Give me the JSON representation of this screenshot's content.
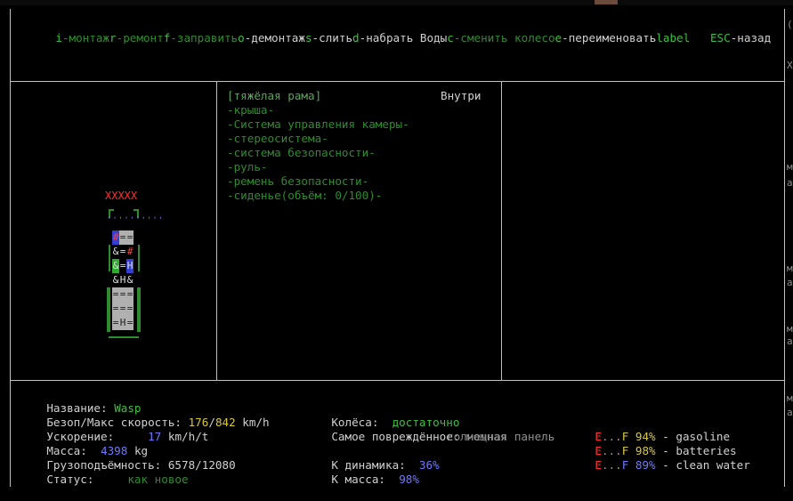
{
  "hotkeys": [
    {
      "key": "i",
      "label": "-монтаж"
    },
    {
      "key": "r",
      "label": "-ремонт"
    },
    {
      "key": "f",
      "label": "-заправить"
    },
    {
      "key": "o",
      "label": "-демонтаж"
    },
    {
      "key": "s",
      "label": "-слить"
    },
    {
      "key": "d",
      "label": "-набрать Воды"
    },
    {
      "key": "c",
      "label": "-сменить колесо"
    },
    {
      "key": "e",
      "label": "-переименовать"
    },
    {
      "key": "",
      "label": "label"
    },
    {
      "key": "ESC",
      "label": "-назад"
    }
  ],
  "right_edge_glyphs": [
    "(",
    "X",
    "м",
    "а",
    "м",
    "а",
    "м",
    "а",
    "м",
    "а"
  ],
  "vehicle": {
    "header_marks": "XXXXX",
    "grid_glyphs": [
      "#",
      "=",
      "=",
      "&",
      "=",
      "#",
      "&",
      "=",
      "H",
      "&",
      "H",
      "&",
      "=",
      "=",
      "=",
      "=",
      "=",
      "=",
      "=",
      "H",
      "="
    ]
  },
  "parts_panel": {
    "title": "[тяжёлая рама]",
    "location": "Внутри",
    "items": [
      "-крыша-",
      "-Система управления камеры-",
      "-стереосистема-",
      "-система безопасности-",
      "-руль-",
      "-ремень безопасности-",
      "-сиденье(объём: 0/100)-"
    ]
  },
  "stats": {
    "name_label": "Название:",
    "name_value": "Wasp",
    "speed_label": "Безоп/Макс скорость:",
    "speed_safe": "176",
    "speed_sep": "/",
    "speed_max": "842",
    "speed_unit": "km/h",
    "accel_label": "Ускорение:",
    "accel_value": "17",
    "accel_unit": "km/h/t",
    "mass_label": "Масса:",
    "mass_value": "4398",
    "mass_unit": "kg",
    "cargo_label": "Грузоподъёмность:",
    "cargo_value": "6578/12080",
    "status_label": "Статус:",
    "status_value": "как новое",
    "wheels_label": "Колёса:",
    "wheels_value": "достаточно",
    "damaged_label": "Самое повреждённое:",
    "damaged_value_1": "мощная",
    "damaged_value_2": "солнечная панель",
    "k_dyn_label": "К динамика:",
    "k_dyn_value": "36%",
    "k_mass_label": "К масса:",
    "k_mass_value": "98%"
  },
  "fuel": [
    {
      "e": "E",
      "dots": "...",
      "f": "F",
      "percent": "94%",
      "name": "- gasoline"
    },
    {
      "e": "E",
      "dots": "...",
      "f": "F",
      "percent": "98%",
      "name": "- batteries"
    },
    {
      "e": "E",
      "dots": "...",
      "f": "F",
      "percent": "89%",
      "name": "- clean water"
    }
  ],
  "colors": {
    "key_green": "#3fbf3f",
    "label_green": "#2e8b2e",
    "value_yellow": "#d8c83a",
    "value_blue": "#6f78ff",
    "danger_red": "#ff3030",
    "border": "#c0c0c0"
  }
}
